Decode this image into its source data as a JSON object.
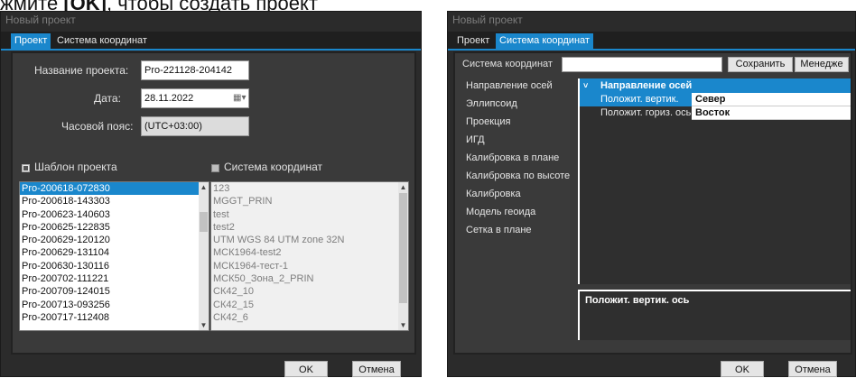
{
  "heading": {
    "prefix": "жмите ",
    "key": "[OK]",
    "suffix": ", чтобы создать проект"
  },
  "left": {
    "title": "Новый проект",
    "tabs": [
      "Проект",
      "Система координат"
    ],
    "form": {
      "name_label": "Название проекта:",
      "name_value": "Pro-221128-204142",
      "date_label": "Дата:",
      "date_value": "28.11.2022",
      "tz_label": "Часовой пояс:",
      "tz_value": "(UTC+03:00)"
    },
    "template_check_label": "Шаблон проекта",
    "coords_check_label": "Система координат",
    "template_list": [
      "Pro-200618-072830",
      "Pro-200618-143303",
      "Pro-200623-140603",
      "Pro-200625-122835",
      "Pro-200629-120120",
      "Pro-200629-131104",
      "Pro-200630-130116",
      "Pro-200702-111221",
      "Pro-200709-124015",
      "Pro-200713-093256",
      "Pro-200717-112408"
    ],
    "coords_list": [
      "123",
      "MGGT_PRIN",
      "test",
      "test2",
      "UTM WGS 84 UTM zone 32N",
      "МСК1964-test2",
      "МСК1964-тест-1",
      "МСК50_Зона_2_PRIN",
      "СК42_10",
      "СК42_15",
      "СК42_6"
    ],
    "ok_label": "OK",
    "cancel_label": "Отмена"
  },
  "right": {
    "title": "Новый проект",
    "tabs": [
      "Проект",
      "Система координат"
    ],
    "cs_label": "Система координат",
    "cs_value": "",
    "save_label": "Сохранить",
    "manager_label": "Менедже",
    "categories": [
      "Направление осей",
      "Эллипсоид",
      "Проекция",
      "ИГД",
      "Калибровка в плане",
      "Калибровка по высоте",
      "Калибровка",
      "Модель геоида",
      "Сетка в плане"
    ],
    "group_header": "Направление осей",
    "props": [
      {
        "name": "Положит. вертик. ось",
        "value": "Север"
      },
      {
        "name": "Положит. гориз. ось",
        "value": "Восток"
      }
    ],
    "description_title": "Положит. вертик. ось",
    "ok_label": "OK",
    "cancel_label": "Отмена"
  }
}
